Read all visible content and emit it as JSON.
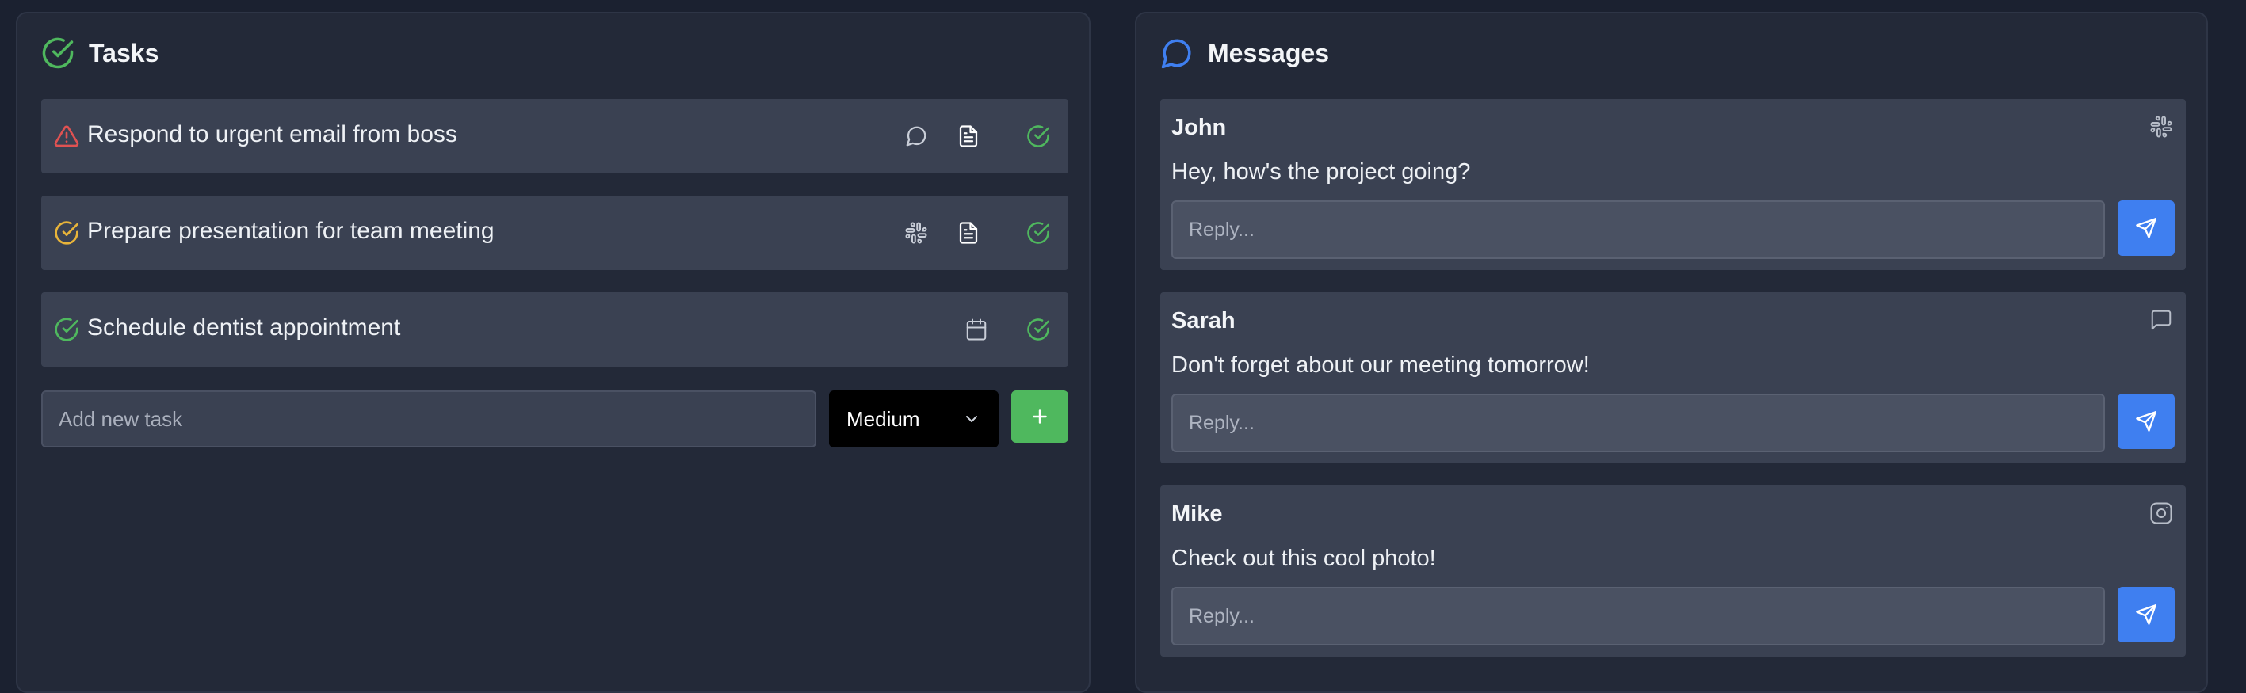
{
  "colors": {
    "background": "#1b2130",
    "panel": "#232938",
    "card": "#3a4152",
    "accent_green": "#4fb85e",
    "accent_blue": "#3f7ff0",
    "warning_red": "#e05252",
    "pending_yellow": "#e8b43a"
  },
  "tasks_panel": {
    "title": "Tasks",
    "title_icon": "check-circle-icon",
    "tasks": [
      {
        "text": "Respond to urgent email from boss",
        "status_icon": "alert-triangle-icon",
        "actions": [
          "message-circle-icon",
          "document-icon",
          "check-circle-icon"
        ]
      },
      {
        "text": "Prepare presentation for team meeting",
        "status_icon": "check-circle-icon",
        "actions": [
          "slack-icon",
          "document-icon",
          "check-circle-icon"
        ]
      },
      {
        "text": "Schedule dentist appointment",
        "status_icon": "check-circle-icon",
        "actions": [
          "calendar-icon",
          "check-circle-icon"
        ]
      }
    ],
    "new_task": {
      "placeholder": "Add new task",
      "priority_selected": "Medium",
      "add_icon": "plus-icon"
    }
  },
  "messages_panel": {
    "title": "Messages",
    "title_icon": "message-circle-icon",
    "messages": [
      {
        "sender": "John",
        "text": "Hey, how's the project going?",
        "source_icon": "slack-icon",
        "reply_placeholder": "Reply..."
      },
      {
        "sender": "Sarah",
        "text": "Don't forget about our meeting tomorrow!",
        "source_icon": "message-square-icon",
        "reply_placeholder": "Reply..."
      },
      {
        "sender": "Mike",
        "text": "Check out this cool photo!",
        "source_icon": "instagram-icon",
        "reply_placeholder": "Reply..."
      }
    ]
  }
}
